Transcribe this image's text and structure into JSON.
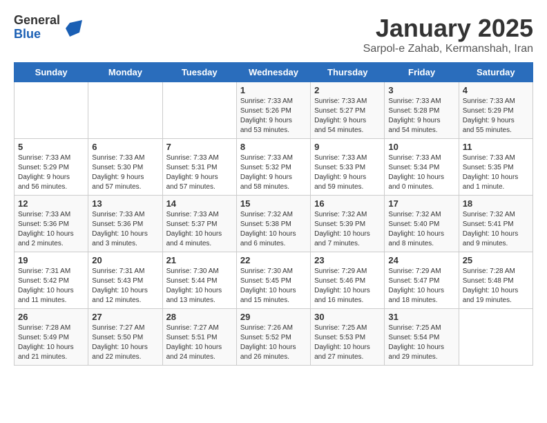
{
  "header": {
    "logo_general": "General",
    "logo_blue": "Blue",
    "title": "January 2025",
    "subtitle": "Sarpol-e Zahab, Kermanshah, Iran"
  },
  "days_of_week": [
    "Sunday",
    "Monday",
    "Tuesday",
    "Wednesday",
    "Thursday",
    "Friday",
    "Saturday"
  ],
  "weeks": [
    [
      {
        "day": "",
        "info": ""
      },
      {
        "day": "",
        "info": ""
      },
      {
        "day": "",
        "info": ""
      },
      {
        "day": "1",
        "info": "Sunrise: 7:33 AM\nSunset: 5:26 PM\nDaylight: 9 hours\nand 53 minutes."
      },
      {
        "day": "2",
        "info": "Sunrise: 7:33 AM\nSunset: 5:27 PM\nDaylight: 9 hours\nand 54 minutes."
      },
      {
        "day": "3",
        "info": "Sunrise: 7:33 AM\nSunset: 5:28 PM\nDaylight: 9 hours\nand 54 minutes."
      },
      {
        "day": "4",
        "info": "Sunrise: 7:33 AM\nSunset: 5:29 PM\nDaylight: 9 hours\nand 55 minutes."
      }
    ],
    [
      {
        "day": "5",
        "info": "Sunrise: 7:33 AM\nSunset: 5:29 PM\nDaylight: 9 hours\nand 56 minutes."
      },
      {
        "day": "6",
        "info": "Sunrise: 7:33 AM\nSunset: 5:30 PM\nDaylight: 9 hours\nand 57 minutes."
      },
      {
        "day": "7",
        "info": "Sunrise: 7:33 AM\nSunset: 5:31 PM\nDaylight: 9 hours\nand 57 minutes."
      },
      {
        "day": "8",
        "info": "Sunrise: 7:33 AM\nSunset: 5:32 PM\nDaylight: 9 hours\nand 58 minutes."
      },
      {
        "day": "9",
        "info": "Sunrise: 7:33 AM\nSunset: 5:33 PM\nDaylight: 9 hours\nand 59 minutes."
      },
      {
        "day": "10",
        "info": "Sunrise: 7:33 AM\nSunset: 5:34 PM\nDaylight: 10 hours\nand 0 minutes."
      },
      {
        "day": "11",
        "info": "Sunrise: 7:33 AM\nSunset: 5:35 PM\nDaylight: 10 hours\nand 1 minute."
      }
    ],
    [
      {
        "day": "12",
        "info": "Sunrise: 7:33 AM\nSunset: 5:36 PM\nDaylight: 10 hours\nand 2 minutes."
      },
      {
        "day": "13",
        "info": "Sunrise: 7:33 AM\nSunset: 5:36 PM\nDaylight: 10 hours\nand 3 minutes."
      },
      {
        "day": "14",
        "info": "Sunrise: 7:33 AM\nSunset: 5:37 PM\nDaylight: 10 hours\nand 4 minutes."
      },
      {
        "day": "15",
        "info": "Sunrise: 7:32 AM\nSunset: 5:38 PM\nDaylight: 10 hours\nand 6 minutes."
      },
      {
        "day": "16",
        "info": "Sunrise: 7:32 AM\nSunset: 5:39 PM\nDaylight: 10 hours\nand 7 minutes."
      },
      {
        "day": "17",
        "info": "Sunrise: 7:32 AM\nSunset: 5:40 PM\nDaylight: 10 hours\nand 8 minutes."
      },
      {
        "day": "18",
        "info": "Sunrise: 7:32 AM\nSunset: 5:41 PM\nDaylight: 10 hours\nand 9 minutes."
      }
    ],
    [
      {
        "day": "19",
        "info": "Sunrise: 7:31 AM\nSunset: 5:42 PM\nDaylight: 10 hours\nand 11 minutes."
      },
      {
        "day": "20",
        "info": "Sunrise: 7:31 AM\nSunset: 5:43 PM\nDaylight: 10 hours\nand 12 minutes."
      },
      {
        "day": "21",
        "info": "Sunrise: 7:30 AM\nSunset: 5:44 PM\nDaylight: 10 hours\nand 13 minutes."
      },
      {
        "day": "22",
        "info": "Sunrise: 7:30 AM\nSunset: 5:45 PM\nDaylight: 10 hours\nand 15 minutes."
      },
      {
        "day": "23",
        "info": "Sunrise: 7:29 AM\nSunset: 5:46 PM\nDaylight: 10 hours\nand 16 minutes."
      },
      {
        "day": "24",
        "info": "Sunrise: 7:29 AM\nSunset: 5:47 PM\nDaylight: 10 hours\nand 18 minutes."
      },
      {
        "day": "25",
        "info": "Sunrise: 7:28 AM\nSunset: 5:48 PM\nDaylight: 10 hours\nand 19 minutes."
      }
    ],
    [
      {
        "day": "26",
        "info": "Sunrise: 7:28 AM\nSunset: 5:49 PM\nDaylight: 10 hours\nand 21 minutes."
      },
      {
        "day": "27",
        "info": "Sunrise: 7:27 AM\nSunset: 5:50 PM\nDaylight: 10 hours\nand 22 minutes."
      },
      {
        "day": "28",
        "info": "Sunrise: 7:27 AM\nSunset: 5:51 PM\nDaylight: 10 hours\nand 24 minutes."
      },
      {
        "day": "29",
        "info": "Sunrise: 7:26 AM\nSunset: 5:52 PM\nDaylight: 10 hours\nand 26 minutes."
      },
      {
        "day": "30",
        "info": "Sunrise: 7:25 AM\nSunset: 5:53 PM\nDaylight: 10 hours\nand 27 minutes."
      },
      {
        "day": "31",
        "info": "Sunrise: 7:25 AM\nSunset: 5:54 PM\nDaylight: 10 hours\nand 29 minutes."
      },
      {
        "day": "",
        "info": ""
      }
    ]
  ]
}
